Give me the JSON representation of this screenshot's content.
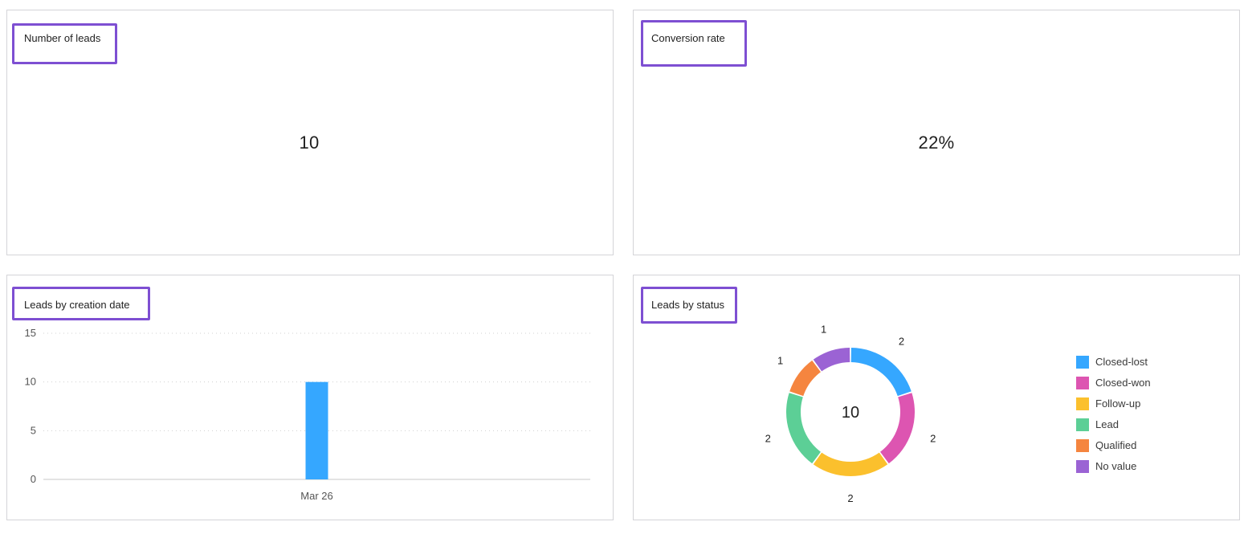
{
  "cards": {
    "number_of_leads": {
      "title": "Number of leads",
      "value": "10"
    },
    "conversion_rate": {
      "title": "Conversion rate",
      "value": "22%"
    },
    "leads_by_creation_date": {
      "title": "Leads by creation date"
    },
    "leads_by_status": {
      "title": "Leads by status",
      "center_value": "10"
    }
  },
  "colors": {
    "highlight_border": "#7e4fd2",
    "bar": "#35a7ff"
  },
  "chart_data": [
    {
      "type": "bar",
      "title": "Leads by creation date",
      "categories": [
        "Mar 26"
      ],
      "values": [
        10
      ],
      "xlabel": "",
      "ylabel": "",
      "ylim": [
        0,
        15
      ],
      "yticks": [
        0,
        5,
        10,
        15
      ],
      "grid": true,
      "color": "#35a7ff"
    },
    {
      "type": "pie",
      "title": "Leads by status",
      "donut": true,
      "center_label": "10",
      "legend_position": "right",
      "slices": [
        {
          "label": "Closed-lost",
          "value": 2,
          "color": "#35a7ff"
        },
        {
          "label": "Closed-won",
          "value": 2,
          "color": "#dd55b1"
        },
        {
          "label": "Follow-up",
          "value": 2,
          "color": "#fbc02d"
        },
        {
          "label": "Lead",
          "value": 2,
          "color": "#5ccf96"
        },
        {
          "label": "Qualified",
          "value": 1,
          "color": "#f5853f"
        },
        {
          "label": "No value",
          "value": 1,
          "color": "#9b63d4"
        }
      ]
    }
  ]
}
